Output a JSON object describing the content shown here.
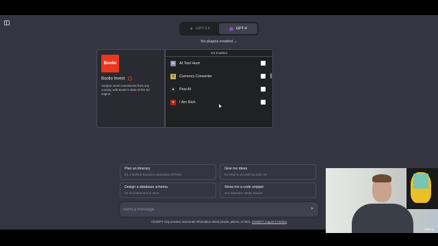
{
  "header": {
    "models": [
      {
        "label": "GPT-3.5",
        "icon": "sparkle-icon"
      },
      {
        "label": "GPT-4",
        "icon": "plugin-icon"
      }
    ],
    "plugins_dropdown": "No plugins enabled"
  },
  "plugin_detail": {
    "logo_text": "Boolio",
    "name": "Boolio Invest",
    "description": "Analyze stock investments from any country, with Boolio's state-of-the-art engine."
  },
  "plugin_list": {
    "header": "0/3 Enabled",
    "items": [
      {
        "label": "AI Tool Hunt"
      },
      {
        "label": "Currency Converter"
      },
      {
        "label": "Pexi AI"
      },
      {
        "label": "I Am Rich"
      }
    ]
  },
  "suggestions": [
    {
      "title": "Plan an itinerary",
      "subtitle": "for a fashion-focused exploration of Paris"
    },
    {
      "title": "Give me ideas",
      "subtitle": "for what to do with my kids' art"
    },
    {
      "title": "Design a database schema",
      "subtitle": "for an online merch store"
    },
    {
      "title": "Show me a code snippet",
      "subtitle": "of a website's sticky header"
    }
  ],
  "composer": {
    "placeholder": "Send a message"
  },
  "footer": {
    "disclaimer": "ChatGPT may produce inaccurate information about people, places, or facts.",
    "version_link": "ChatGPT August 3 Version"
  },
  "webcam": {
    "watermark": "Udemy"
  },
  "colors": {
    "background": "#343541",
    "accent_logo": "#e8381d"
  }
}
